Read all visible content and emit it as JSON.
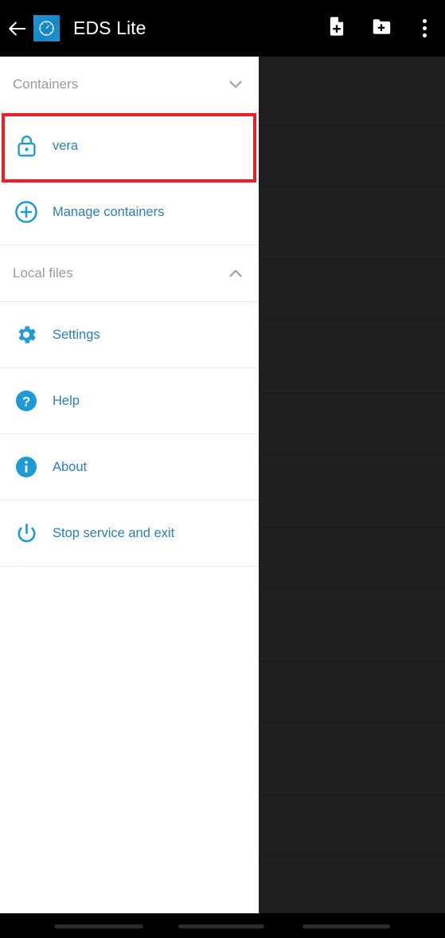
{
  "appbar": {
    "back_icon": "back-arrow-icon",
    "app_icon": "eds-clock-icon",
    "title": "EDS Lite",
    "actions": [
      {
        "name": "new-file-button",
        "icon": "file-plus-icon"
      },
      {
        "name": "new-folder-button",
        "icon": "folder-plus-icon"
      },
      {
        "name": "overflow-menu-button",
        "icon": "more-vertical-icon"
      }
    ]
  },
  "drawer": {
    "sections": [
      {
        "title": "Containers",
        "chevron": "chevron-down-icon",
        "expanded": true,
        "items": [
          {
            "label": "vera",
            "icon": "lock-icon",
            "highlighted": true
          },
          {
            "label": "Manage containers",
            "icon": "plus-circle-icon",
            "highlighted": false
          }
        ]
      },
      {
        "title": "Local files",
        "chevron": "chevron-up-icon",
        "expanded": false,
        "items": []
      }
    ],
    "menu_items": [
      {
        "label": "Settings",
        "icon": "gear-icon"
      },
      {
        "label": "Help",
        "icon": "help-circle-icon"
      },
      {
        "label": "About",
        "icon": "info-circle-icon"
      },
      {
        "label": "Stop service and exit",
        "icon": "power-icon"
      }
    ]
  },
  "colors": {
    "accent_blue": "#1e9ad6",
    "link_text": "#2b7fb5",
    "highlight_red": "#e8202a",
    "section_label": "#9a9a9a",
    "appbar_bg": "#000000",
    "scrim": "#1e1e1e"
  },
  "navbar": {
    "pills": [
      "recents-pill",
      "home-pill",
      "back-pill"
    ]
  }
}
